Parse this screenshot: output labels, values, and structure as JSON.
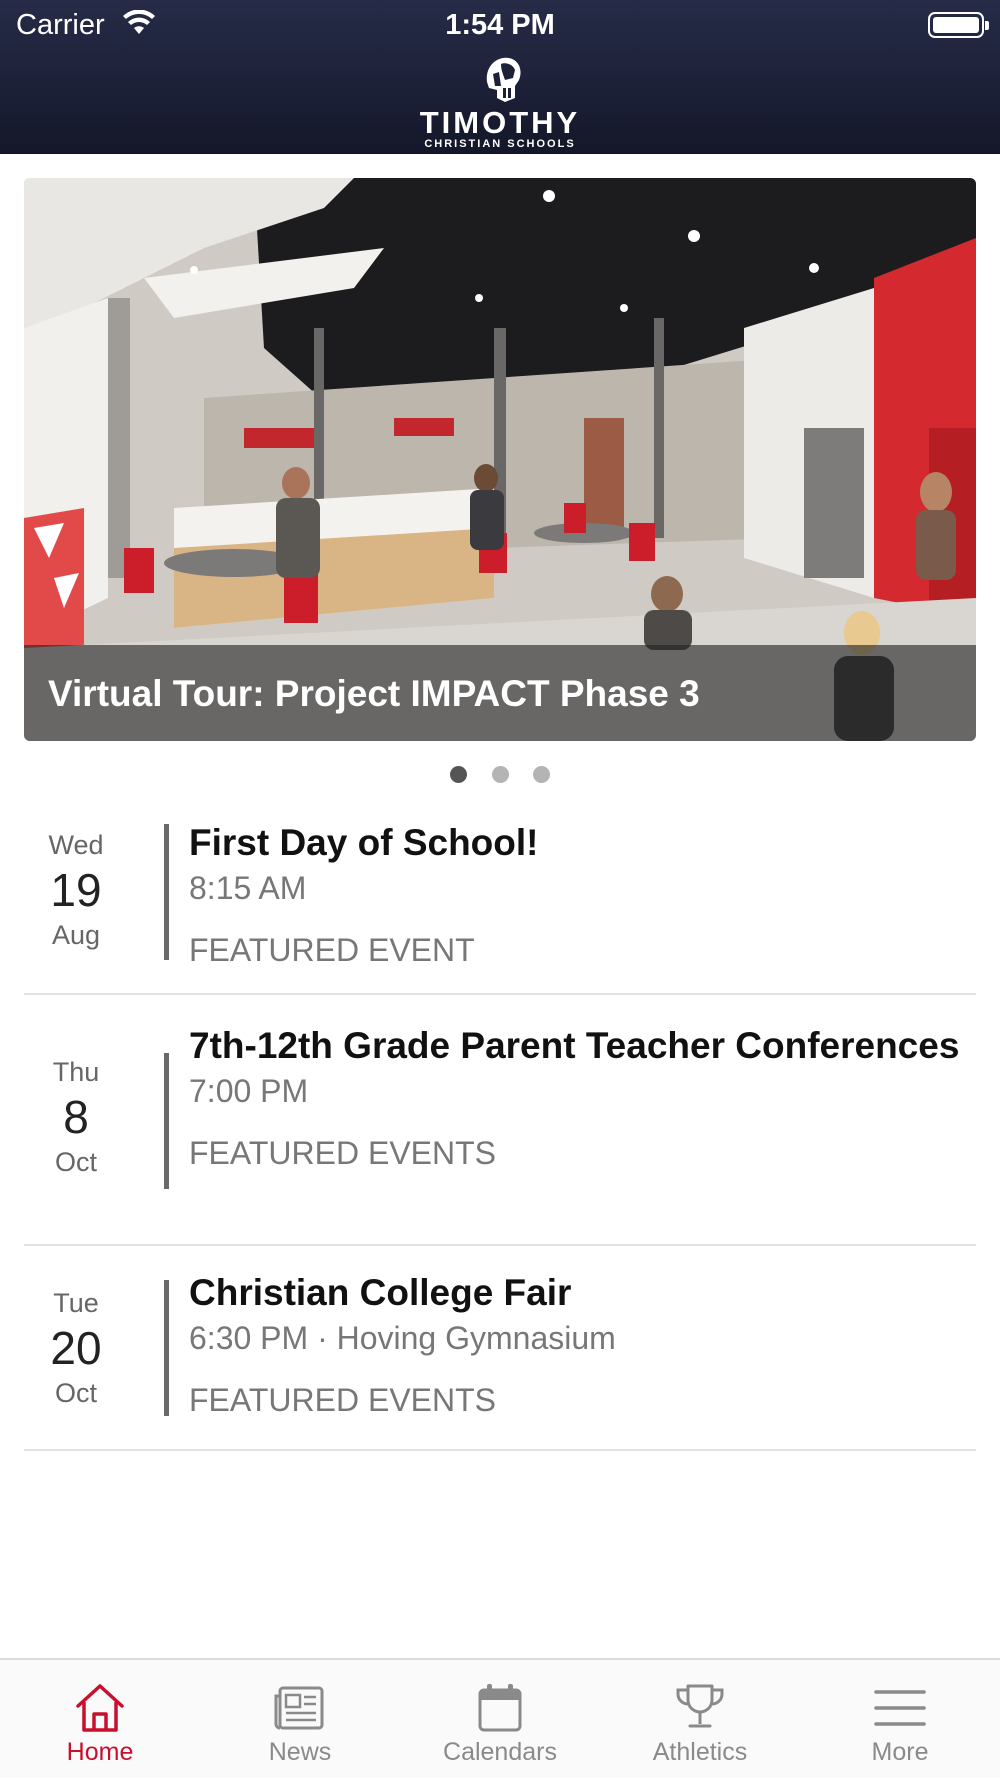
{
  "status_bar": {
    "carrier": "Carrier",
    "time": "1:54 PM"
  },
  "header": {
    "logo_title": "TIMOTHY",
    "logo_subtitle": "CHRISTIAN SCHOOLS"
  },
  "carousel": {
    "slide_caption": "Virtual Tour: Project IMPACT Phase 3",
    "page_count": 3,
    "active_index": 0
  },
  "events": [
    {
      "weekday": "Wed",
      "day": "19",
      "month": "Aug",
      "title": "First Day of School!",
      "time": "8:15 AM",
      "category": "FEATURED EVENT"
    },
    {
      "weekday": "Thu",
      "day": "8",
      "month": "Oct",
      "title": "7th-12th Grade Parent Teacher Conferences",
      "time": "7:00 PM",
      "category": "FEATURED EVENTS"
    },
    {
      "weekday": "Tue",
      "day": "20",
      "month": "Oct",
      "title": "Christian College Fair",
      "time": "6:30 PM · Hoving Gymnasium",
      "category": "FEATURED EVENTS"
    }
  ],
  "tabbar": {
    "items": [
      {
        "label": "Home",
        "icon": "home-icon",
        "active": true
      },
      {
        "label": "News",
        "icon": "newspaper-icon",
        "active": false
      },
      {
        "label": "Calendars",
        "icon": "calendar-icon",
        "active": false
      },
      {
        "label": "Athletics",
        "icon": "trophy-icon",
        "active": false
      },
      {
        "label": "More",
        "icon": "menu-icon",
        "active": false
      }
    ]
  },
  "colors": {
    "header_navy": "#1d2138",
    "accent_red": "#c8102e",
    "inactive_gray": "#8a8a8a"
  }
}
